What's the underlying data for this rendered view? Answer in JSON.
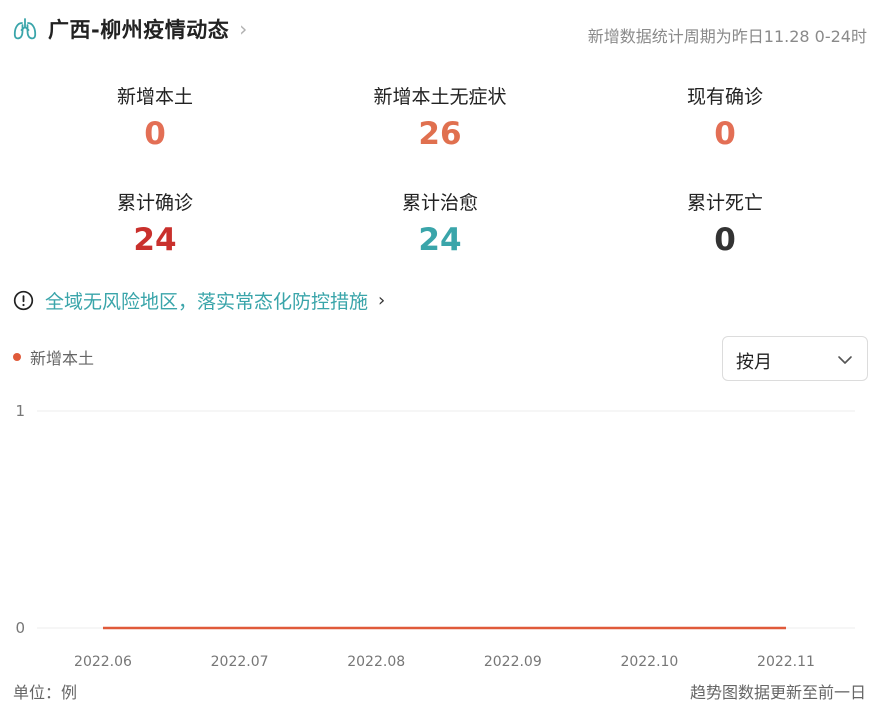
{
  "header": {
    "title": "广西-柳州疫情动态",
    "period_note": "新增数据统计周期为昨日11.28 0-24时",
    "icon": "lungs-icon"
  },
  "stats": [
    {
      "label": "新增本土",
      "value": "0",
      "color": "#e36f55"
    },
    {
      "label": "新增本土无症状",
      "value": "26",
      "color": "#e0704f"
    },
    {
      "label": "现有确诊",
      "value": "0",
      "color": "#e36f55"
    },
    {
      "label": "累计确诊",
      "value": "24",
      "color": "#c9302c"
    },
    {
      "label": "累计治愈",
      "value": "24",
      "color": "#3aa5aa"
    },
    {
      "label": "累计死亡",
      "value": "0",
      "color": "#333333"
    }
  ],
  "notice": {
    "text": "全域无风险地区，落实常态化防控措施",
    "icon": "exclamation-circle-icon"
  },
  "legend": {
    "label": "新增本土",
    "color": "#e05a3a"
  },
  "select": {
    "value": "按月",
    "icon": "chevron-down-icon"
  },
  "chart_data": {
    "type": "line",
    "x": [
      "2022.06",
      "2022.07",
      "2022.08",
      "2022.09",
      "2022.10",
      "2022.11"
    ],
    "series": [
      {
        "name": "新增本土",
        "values": [
          0,
          0,
          0,
          0,
          0,
          0
        ],
        "color": "#e05a3a"
      }
    ],
    "yticks": [
      "0",
      "1"
    ],
    "ylim": [
      0,
      1
    ],
    "grid": true
  },
  "footer": {
    "unit": "单位：例",
    "note": "趋势图数据更新至前一日"
  }
}
